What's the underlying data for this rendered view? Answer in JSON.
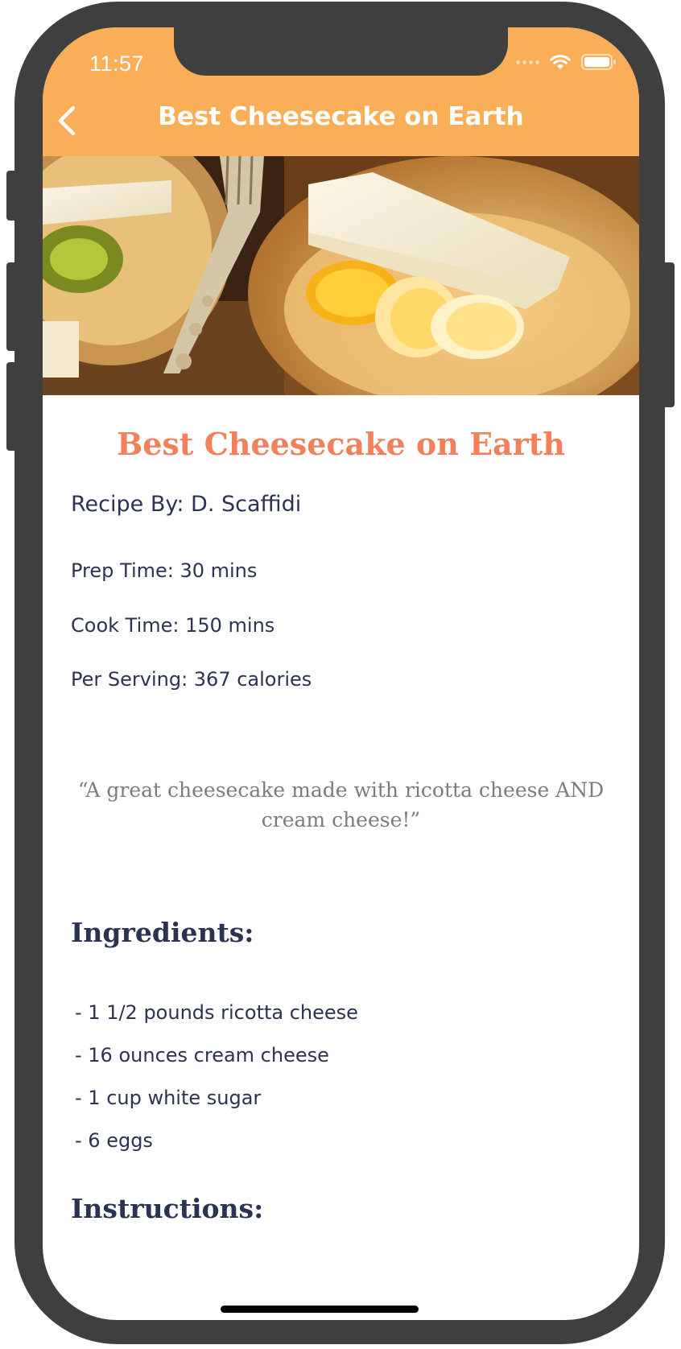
{
  "status_bar": {
    "time": "11:57"
  },
  "nav": {
    "title": "Best Cheesecake on Earth",
    "back_icon": "chevron-left-icon"
  },
  "colors": {
    "header": "#fbae58",
    "title_accent": "#f2815b",
    "text_dark": "#2c3350",
    "quote_gray": "#7c7c7c"
  },
  "recipe": {
    "title": "Best Cheesecake on Earth",
    "author": "Recipe By: D. Scaffidi",
    "prep_time": "Prep Time: 30 mins",
    "cook_time": "Cook Time: 150 mins",
    "per_serving": "Per Serving: 367 calories",
    "quote": "“A great cheesecake made with ricotta cheese AND cream cheese!”",
    "ingredients_heading": "Ingredients:",
    "ingredients": [
      " - 1 1/2 pounds ricotta cheese",
      " - 16 ounces cream cheese",
      " - 1 cup white sugar",
      " - 6 eggs"
    ],
    "instructions_heading": "Instructions:"
  }
}
